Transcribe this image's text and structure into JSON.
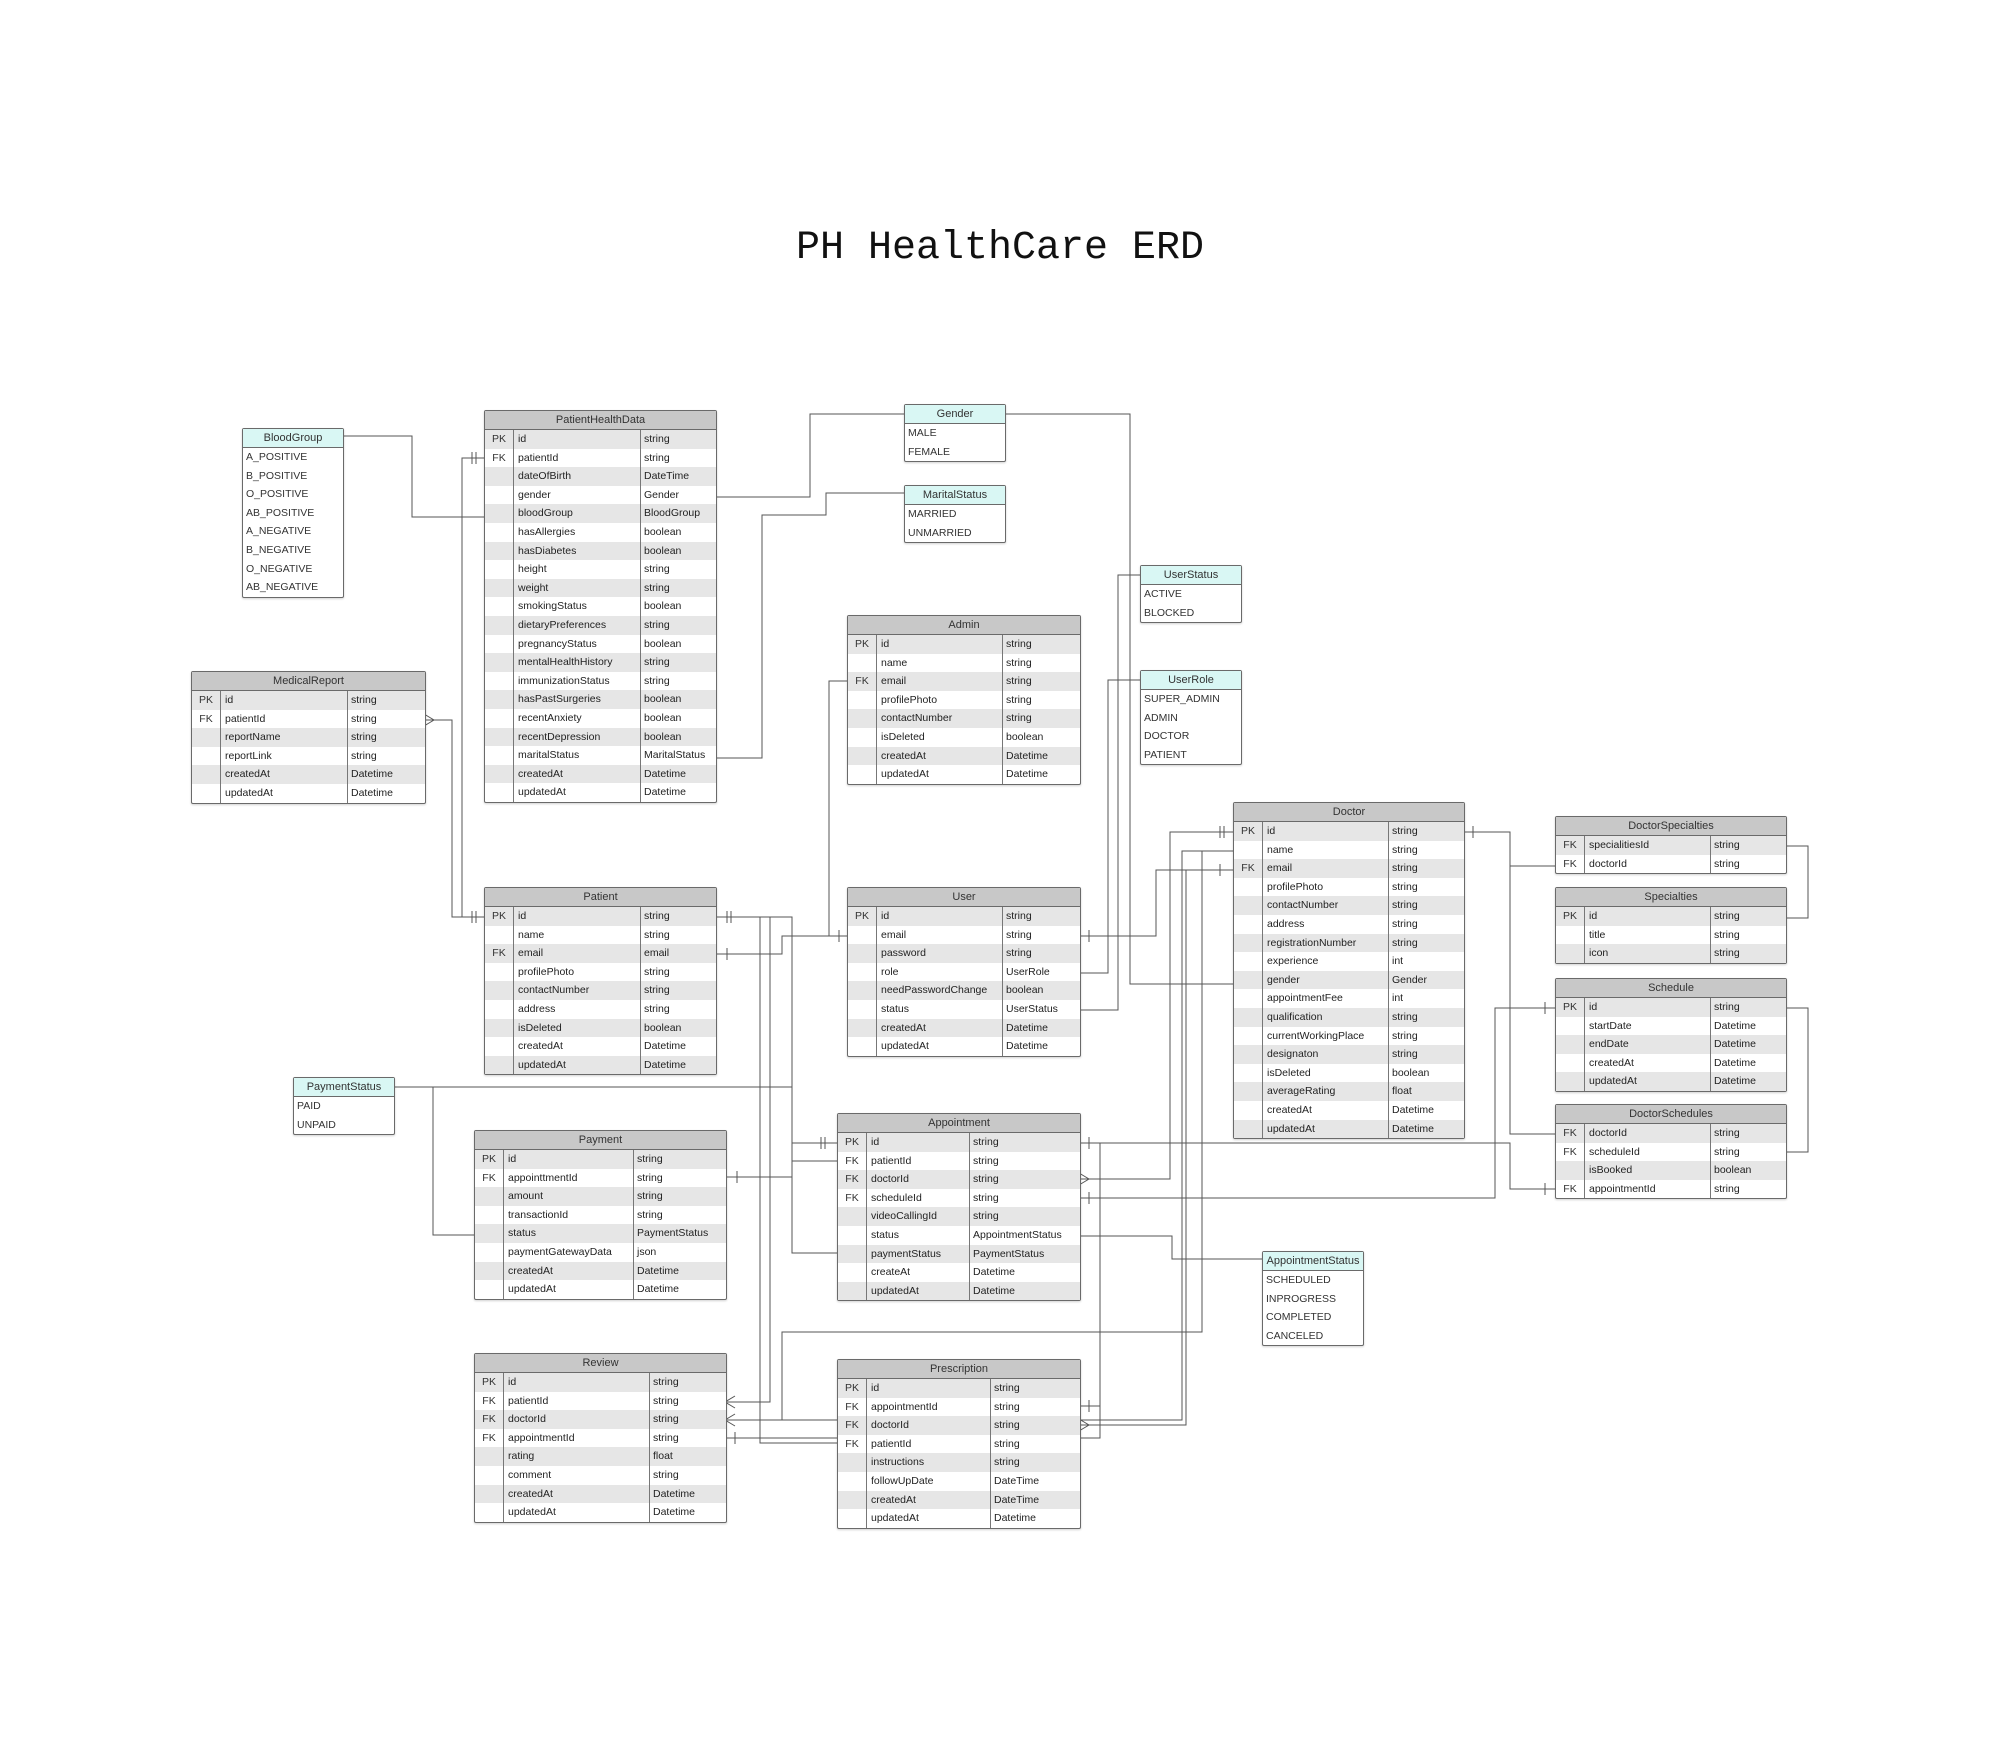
{
  "title": "PH HealthCare ERD",
  "enums": [
    {
      "id": "BloodGroup",
      "name": "BloodGroup",
      "values": [
        "A_POSITIVE",
        "B_POSITIVE",
        "O_POSITIVE",
        "AB_POSITIVE",
        "A_NEGATIVE",
        "B_NEGATIVE",
        "O_NEGATIVE",
        "AB_NEGATIVE"
      ]
    },
    {
      "id": "Gender",
      "name": "Gender",
      "values": [
        "MALE",
        "FEMALE"
      ]
    },
    {
      "id": "MaritalStatus",
      "name": "MaritalStatus",
      "values": [
        "MARRIED",
        "UNMARRIED"
      ]
    },
    {
      "id": "UserStatus",
      "name": "UserStatus",
      "values": [
        "ACTIVE",
        "BLOCKED"
      ]
    },
    {
      "id": "UserRole",
      "name": "UserRole",
      "values": [
        "SUPER_ADMIN",
        "ADMIN",
        "DOCTOR",
        "PATIENT"
      ]
    },
    {
      "id": "PaymentStatus",
      "name": "PaymentStatus",
      "values": [
        "PAID",
        "UNPAID"
      ]
    },
    {
      "id": "AppointmentStatus",
      "name": "AppointmentStatus",
      "values": [
        "SCHEDULED",
        "INPROGRESS",
        "COMPLETED",
        "CANCELED"
      ]
    }
  ],
  "entities": [
    {
      "id": "PatientHealthData",
      "name": "PatientHealthData",
      "rows": [
        [
          "PK",
          "id",
          "string"
        ],
        [
          "FK",
          "patientId",
          "string"
        ],
        [
          "",
          "dateOfBirth",
          "DateTime"
        ],
        [
          "",
          "gender",
          "Gender"
        ],
        [
          "",
          "bloodGroup",
          "BloodGroup"
        ],
        [
          "",
          "hasAllergies",
          "boolean"
        ],
        [
          "",
          "hasDiabetes",
          "boolean"
        ],
        [
          "",
          "height",
          "string"
        ],
        [
          "",
          "weight",
          "string"
        ],
        [
          "",
          "smokingStatus",
          "boolean"
        ],
        [
          "",
          "dietaryPreferences",
          "string"
        ],
        [
          "",
          "pregnancyStatus",
          "boolean"
        ],
        [
          "",
          "mentalHealthHistory",
          "string"
        ],
        [
          "",
          "immunizationStatus",
          "string"
        ],
        [
          "",
          "hasPastSurgeries",
          "boolean"
        ],
        [
          "",
          "recentAnxiety",
          "boolean"
        ],
        [
          "",
          "recentDepression",
          "boolean"
        ],
        [
          "",
          "maritalStatus",
          "MaritalStatus"
        ],
        [
          "",
          "createdAt",
          "Datetime"
        ],
        [
          "",
          "updatedAt",
          "Datetime"
        ]
      ]
    },
    {
      "id": "MedicalReport",
      "name": "MedicalReport",
      "rows": [
        [
          "PK",
          "id",
          "string"
        ],
        [
          "FK",
          "patientId",
          "string"
        ],
        [
          "",
          "reportName",
          "string"
        ],
        [
          "",
          "reportLink",
          "string"
        ],
        [
          "",
          "createdAt",
          "Datetime"
        ],
        [
          "",
          "updatedAt",
          "Datetime"
        ]
      ]
    },
    {
      "id": "Admin",
      "name": "Admin",
      "rows": [
        [
          "PK",
          "id",
          "string"
        ],
        [
          "",
          "name",
          "string"
        ],
        [
          "FK",
          "email",
          "string"
        ],
        [
          "",
          "profilePhoto",
          "string"
        ],
        [
          "",
          "contactNumber",
          "string"
        ],
        [
          "",
          "isDeleted",
          "boolean"
        ],
        [
          "",
          "createdAt",
          "Datetime"
        ],
        [
          "",
          "updatedAt",
          "Datetime"
        ]
      ]
    },
    {
      "id": "Patient",
      "name": "Patient",
      "rows": [
        [
          "PK",
          "id",
          "string"
        ],
        [
          "",
          "name",
          "string"
        ],
        [
          "FK",
          "email",
          "email"
        ],
        [
          "",
          "profilePhoto",
          "string"
        ],
        [
          "",
          "contactNumber",
          "string"
        ],
        [
          "",
          "address",
          "string"
        ],
        [
          "",
          "isDeleted",
          "boolean"
        ],
        [
          "",
          "createdAt",
          "Datetime"
        ],
        [
          "",
          "updatedAt",
          "Datetime"
        ]
      ]
    },
    {
      "id": "User",
      "name": "User",
      "rows": [
        [
          "PK",
          "id",
          "string"
        ],
        [
          "",
          "email",
          "string"
        ],
        [
          "",
          "password",
          "string"
        ],
        [
          "",
          "role",
          "UserRole"
        ],
        [
          "",
          "needPasswordChange",
          "boolean"
        ],
        [
          "",
          "status",
          "UserStatus"
        ],
        [
          "",
          "createdAt",
          "Datetime"
        ],
        [
          "",
          "updatedAt",
          "Datetime"
        ]
      ]
    },
    {
      "id": "Doctor",
      "name": "Doctor",
      "rows": [
        [
          "PK",
          "id",
          "string"
        ],
        [
          "",
          "name",
          "string"
        ],
        [
          "FK",
          "email",
          "string"
        ],
        [
          "",
          "profilePhoto",
          "string"
        ],
        [
          "",
          "contactNumber",
          "string"
        ],
        [
          "",
          "address",
          "string"
        ],
        [
          "",
          "registrationNumber",
          "string"
        ],
        [
          "",
          "experience",
          "int"
        ],
        [
          "",
          "gender",
          "Gender"
        ],
        [
          "",
          "appointmentFee",
          "int"
        ],
        [
          "",
          "qualification",
          "string"
        ],
        [
          "",
          "currentWorkingPlace",
          "string"
        ],
        [
          "",
          "designaton",
          "string"
        ],
        [
          "",
          "isDeleted",
          "boolean"
        ],
        [
          "",
          "averageRating",
          "float"
        ],
        [
          "",
          "createdAt",
          "Datetime"
        ],
        [
          "",
          "updatedAt",
          "Datetime"
        ]
      ]
    },
    {
      "id": "DoctorSpecialties",
      "name": "DoctorSpecialties",
      "rows": [
        [
          "FK",
          "specialitiesId",
          "string"
        ],
        [
          "FK",
          "doctorId",
          "string"
        ]
      ]
    },
    {
      "id": "Specialties",
      "name": "Specialties",
      "rows": [
        [
          "PK",
          "id",
          "string"
        ],
        [
          "",
          "title",
          "string"
        ],
        [
          "",
          "icon",
          "string"
        ]
      ]
    },
    {
      "id": "Schedule",
      "name": "Schedule",
      "rows": [
        [
          "PK",
          "id",
          "string"
        ],
        [
          "",
          "startDate",
          "Datetime"
        ],
        [
          "",
          "endDate",
          "Datetime"
        ],
        [
          "",
          "createdAt",
          "Datetime"
        ],
        [
          "",
          "updatedAt",
          "Datetime"
        ]
      ]
    },
    {
      "id": "DoctorSchedules",
      "name": "DoctorSchedules",
      "rows": [
        [
          "FK",
          "doctorId",
          "string"
        ],
        [
          "FK",
          "scheduleId",
          "string"
        ],
        [
          "",
          "isBooked",
          "boolean"
        ],
        [
          "FK",
          "appointmentId",
          "string"
        ]
      ]
    },
    {
      "id": "Payment",
      "name": "Payment",
      "rows": [
        [
          "PK",
          "id",
          "string"
        ],
        [
          "FK",
          "appointtmentId",
          "string"
        ],
        [
          "",
          "amount",
          "string"
        ],
        [
          "",
          "transactionId",
          "string"
        ],
        [
          "",
          "status",
          "PaymentStatus"
        ],
        [
          "",
          "paymentGatewayData",
          "json"
        ],
        [
          "",
          "createdAt",
          "Datetime"
        ],
        [
          "",
          "updatedAt",
          "Datetime"
        ]
      ]
    },
    {
      "id": "Appointment",
      "name": "Appointment",
      "rows": [
        [
          "PK",
          "id",
          "string"
        ],
        [
          "FK",
          "patientId",
          "string"
        ],
        [
          "FK",
          "doctorId",
          "string"
        ],
        [
          "FK",
          "scheduleId",
          "string"
        ],
        [
          "",
          "videoCallingId",
          "string"
        ],
        [
          "",
          "status",
          "AppointmentStatus"
        ],
        [
          "",
          "paymentStatus",
          "PaymentStatus"
        ],
        [
          "",
          "createAt",
          "Datetime"
        ],
        [
          "",
          "updatedAt",
          "Datetime"
        ]
      ]
    },
    {
      "id": "Review",
      "name": "Review",
      "rows": [
        [
          "PK",
          "id",
          "string"
        ],
        [
          "FK",
          "patientId",
          "string"
        ],
        [
          "FK",
          "doctorId",
          "string"
        ],
        [
          "FK",
          "appointmentId",
          "string"
        ],
        [
          "",
          "rating",
          "float"
        ],
        [
          "",
          "comment",
          "string"
        ],
        [
          "",
          "createdAt",
          "Datetime"
        ],
        [
          "",
          "updatedAt",
          "Datetime"
        ]
      ]
    },
    {
      "id": "Prescription",
      "name": "Prescription",
      "rows": [
        [
          "PK",
          "id",
          "string"
        ],
        [
          "FK",
          "appointmentId",
          "string"
        ],
        [
          "FK",
          "doctorId",
          "string"
        ],
        [
          "FK",
          "patientId",
          "string"
        ],
        [
          "",
          "instructions",
          "string"
        ],
        [
          "",
          "followUpDate",
          "DateTime"
        ],
        [
          "",
          "createdAt",
          "DateTime"
        ],
        [
          "",
          "updatedAt",
          "Datetime"
        ]
      ]
    }
  ]
}
